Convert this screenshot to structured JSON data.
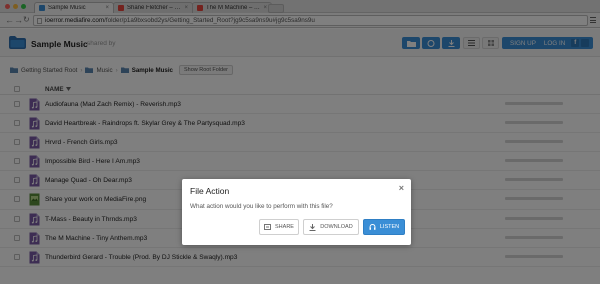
{
  "browser": {
    "tabs": [
      {
        "title": "Sample Music",
        "active": true,
        "favicon_color": "#3a8ed6"
      },
      {
        "title": "Shane Fletcher – Out of S…",
        "active": false,
        "favicon_color": "#e8453c"
      },
      {
        "title": "The M Machine – Tiny Ant…",
        "active": false,
        "favicon_color": "#e8453c"
      }
    ],
    "url_host": "ioerror.mediafire.com",
    "url_path": "/folder/p1a9bxsobd2ys/Getting_Started_Root?jg9c5sa9ns9u#jg9c5sa9ns9u"
  },
  "header": {
    "title": "Sample Music",
    "shared_by": "shared by",
    "signup_label": "SIGN UP",
    "login_label": "LOG IN",
    "facebook_glyph": "f"
  },
  "breadcrumb": {
    "items": [
      "Getting Started Root",
      "Music",
      "Sample Music"
    ],
    "show_folder_label": "Show Root Folder"
  },
  "table": {
    "name_header": "NAME"
  },
  "files": [
    {
      "name": "Audiofauna (Mad Zach Remix) - Reverish.mp3",
      "icon": "audio-file-icon"
    },
    {
      "name": "David Heartbreak - Raindrops ft. Skylar Grey & The Partysquad.mp3",
      "icon": "audio-file-icon"
    },
    {
      "name": "Hrvrd - French Girls.mp3",
      "icon": "audio-file-icon"
    },
    {
      "name": "Impossible Bird - Here I Am.mp3",
      "icon": "audio-file-icon"
    },
    {
      "name": "Manage Quad - Oh Dear.mp3",
      "icon": "audio-file-icon"
    },
    {
      "name": "Share your work on MediaFire.png",
      "icon": "image-file-icon"
    },
    {
      "name": "T-Mass - Beauty in Thrnds.mp3",
      "icon": "audio-file-icon"
    },
    {
      "name": "The M Machine - Tiny Anthem.mp3",
      "icon": "audio-file-icon"
    },
    {
      "name": "Thunderbird Gerard - Trouble (Prod. By DJ Stickle & Swaqly).mp3",
      "icon": "audio-file-icon"
    }
  ],
  "modal": {
    "title": "File Action",
    "message": "What action would you like to perform with this file?",
    "share_label": "SHARE",
    "download_label": "DOWNLOAD",
    "listen_label": "LISTEN"
  },
  "colors": {
    "accent": "#3a8ed6",
    "overlay": "rgba(0,0,0,0.5)",
    "audio_icon": "#7a5aa6"
  }
}
